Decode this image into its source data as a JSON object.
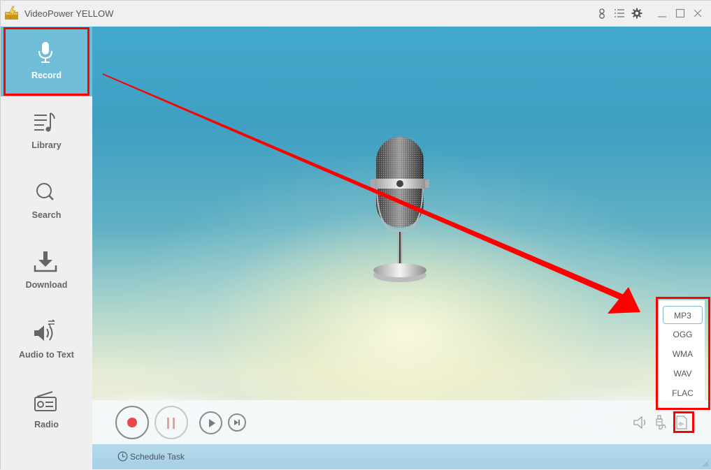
{
  "app": {
    "title": "VideoPower YELLOW"
  },
  "titlebar": {
    "icons": [
      "user-icon",
      "menu-list-icon",
      "settings-gear-icon",
      "minimize-icon",
      "maximize-icon",
      "close-icon"
    ]
  },
  "sidebar": {
    "items": [
      {
        "label": "Record",
        "icon": "microphone-icon",
        "active": true
      },
      {
        "label": "Library",
        "icon": "music-list-icon",
        "active": false
      },
      {
        "label": "Search",
        "icon": "search-icon",
        "active": false
      },
      {
        "label": "Download",
        "icon": "download-icon",
        "active": false
      },
      {
        "label": "Audio to Text",
        "icon": "speaker-convert-icon",
        "active": false
      },
      {
        "label": "Radio",
        "icon": "radio-icon",
        "active": false
      }
    ]
  },
  "controls": {
    "record": "record-icon",
    "pause": "pause-icon",
    "play": "play-icon",
    "next": "skip-next-icon"
  },
  "format_menu": {
    "options": [
      "MP3",
      "OGG",
      "WMA",
      "WAV",
      "FLAC"
    ],
    "selected": "MP3"
  },
  "right_controls": [
    "volume-icon",
    "audio-source-plug-icon",
    "audio-format-file-icon"
  ],
  "status": {
    "schedule_label": "Schedule Task"
  },
  "colors": {
    "accent": "#6fbdd6",
    "annotation_red": "#ff0000",
    "record_red": "#e84848",
    "pause_salmon": "#eaa090"
  }
}
